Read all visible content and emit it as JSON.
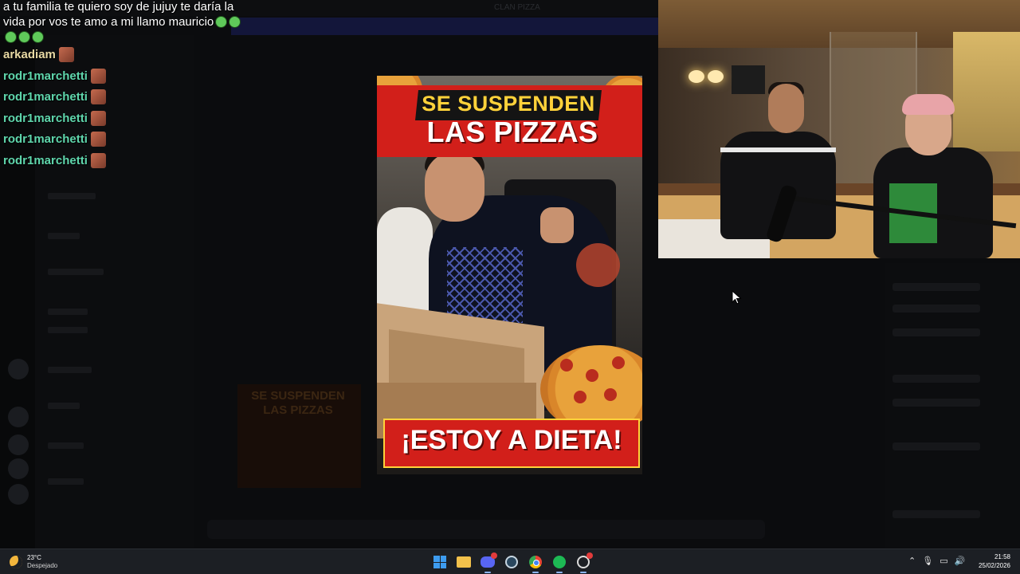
{
  "background": {
    "title_bar_text": "CLAN PIZZA",
    "ghost_thumbnail_title": "SE SUSPENDEN LAS PIZZAS"
  },
  "chat": {
    "first_message": "a tu familia te quiero soy de jujuy te daría la vida por vos te amo a mi llamo mauricio",
    "first_message_emoji_count": 5,
    "lines": [
      {
        "user": "arkadiam",
        "color": "#e8d9a4"
      },
      {
        "user": "rodr1marchetti",
        "color": "#5fd6ac"
      },
      {
        "user": "rodr1marchetti",
        "color": "#5fd6ac"
      },
      {
        "user": "rodr1marchetti",
        "color": "#5fd6ac"
      },
      {
        "user": "rodr1marchetti",
        "color": "#5fd6ac"
      },
      {
        "user": "rodr1marchetti",
        "color": "#5fd6ac"
      }
    ]
  },
  "thumbnail": {
    "line1": "SE SUSPENDEN",
    "line2": "LAS PIZZAS",
    "line3": "¡ESTOY A DIETA!",
    "accent_red": "#d21f1a",
    "accent_yellow": "#ffd23a"
  },
  "taskbar": {
    "weather_temp": "23°C",
    "weather_condition": "Despejado",
    "apps": [
      "windows-start",
      "file-explorer",
      "discord",
      "steam",
      "chrome",
      "spotify",
      "other-app"
    ],
    "clock_time": "21:58",
    "clock_date": "25/02/2026"
  }
}
